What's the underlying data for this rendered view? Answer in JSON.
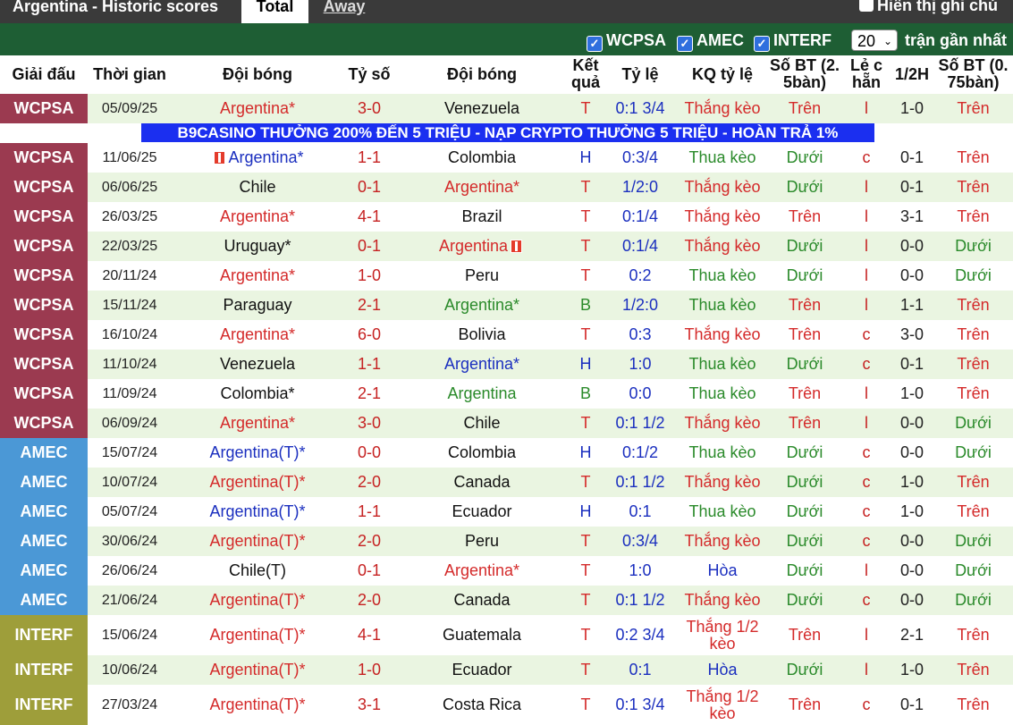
{
  "tabs": {
    "title": "Argentina - Historic scores",
    "total": "Total",
    "away": "Away",
    "show_note": "Hiển thị ghi chú"
  },
  "filters": {
    "wcpsa": "WCPSA",
    "amec": "AMEC",
    "interf": "INTERF",
    "count": "20",
    "count_label": "trận gần nhất"
  },
  "headers": {
    "league": "Giải đấu",
    "time": "Thời gian",
    "home": "Đội bóng",
    "score": "Tỷ số",
    "away": "Đội bóng",
    "result": "Kết quả",
    "handicap": "Tỷ lệ",
    "handicap_result": "KQ tỷ lệ",
    "ou": "Số BT (2. 5bàn)",
    "odd_even": "Lẻ c hẵn",
    "half": "1/2H",
    "ou2": "Số BT (0. 75bàn)"
  },
  "ad_text": "B9CASINO THƯỞNG 200% ĐẾN 5 TRIỆU - NẠP CRYPTO THƯỞNG 5 TRIỆU - HOÀN TRẢ 1%",
  "colors": {
    "wcpsa": "#9b3a50",
    "amec": "#4b98d6",
    "interf": "#9e9e3a",
    "filter_bar": "#1e5e34",
    "ad": "#1b2ff0"
  },
  "rows": [
    {
      "league": "WCPSA",
      "date": "05/09/25",
      "home": "Argentina*",
      "home_color": "red",
      "score": "3-0",
      "away": "Venezuela",
      "away_color": "black",
      "res": "T",
      "hcp": "0:1 3/4",
      "hcpres": "Thắng kèo",
      "ou": "Trên",
      "oe": "l",
      "ht": "1-0",
      "ou2": "Trên"
    },
    {
      "league": "WCPSA",
      "date": "11/06/25",
      "home": "Argentina*",
      "home_color": "blue",
      "home_flag": true,
      "score": "1-1",
      "away": "Colombia",
      "away_color": "black",
      "res": "H",
      "hcp": "0:3/4",
      "hcpres": "Thua kèo",
      "ou": "Dưới",
      "oe": "c",
      "ht": "0-1",
      "ou2": "Trên"
    },
    {
      "league": "WCPSA",
      "date": "06/06/25",
      "home": "Chile",
      "home_color": "black",
      "score": "0-1",
      "away": "Argentina*",
      "away_color": "red",
      "res": "T",
      "hcp": "1/2:0",
      "hcpres": "Thắng kèo",
      "ou": "Dưới",
      "oe": "l",
      "ht": "0-1",
      "ou2": "Trên"
    },
    {
      "league": "WCPSA",
      "date": "26/03/25",
      "home": "Argentina*",
      "home_color": "red",
      "score": "4-1",
      "away": "Brazil",
      "away_color": "black",
      "res": "T",
      "hcp": "0:1/4",
      "hcpres": "Thắng kèo",
      "ou": "Trên",
      "oe": "l",
      "ht": "3-1",
      "ou2": "Trên"
    },
    {
      "league": "WCPSA",
      "date": "22/03/25",
      "home": "Uruguay*",
      "home_color": "black",
      "score": "0-1",
      "away": "Argentina",
      "away_color": "red",
      "away_flag": true,
      "res": "T",
      "hcp": "0:1/4",
      "hcpres": "Thắng kèo",
      "ou": "Dưới",
      "oe": "l",
      "ht": "0-0",
      "ou2": "Dưới"
    },
    {
      "league": "WCPSA",
      "date": "20/11/24",
      "home": "Argentina*",
      "home_color": "red",
      "score": "1-0",
      "away": "Peru",
      "away_color": "black",
      "res": "T",
      "hcp": "0:2",
      "hcpres": "Thua kèo",
      "ou": "Dưới",
      "oe": "l",
      "ht": "0-0",
      "ou2": "Dưới"
    },
    {
      "league": "WCPSA",
      "date": "15/11/24",
      "home": "Paraguay",
      "home_color": "black",
      "score": "2-1",
      "away": "Argentina*",
      "away_color": "green",
      "res": "B",
      "hcp": "1/2:0",
      "hcpres": "Thua kèo",
      "ou": "Trên",
      "oe": "l",
      "ht": "1-1",
      "ou2": "Trên"
    },
    {
      "league": "WCPSA",
      "date": "16/10/24",
      "home": "Argentina*",
      "home_color": "red",
      "score": "6-0",
      "away": "Bolivia",
      "away_color": "black",
      "res": "T",
      "hcp": "0:3",
      "hcpres": "Thắng kèo",
      "ou": "Trên",
      "oe": "c",
      "ht": "3-0",
      "ou2": "Trên"
    },
    {
      "league": "WCPSA",
      "date": "11/10/24",
      "home": "Venezuela",
      "home_color": "black",
      "score": "1-1",
      "away": "Argentina*",
      "away_color": "blue",
      "res": "H",
      "hcp": "1:0",
      "hcpres": "Thua kèo",
      "ou": "Dưới",
      "oe": "c",
      "ht": "0-1",
      "ou2": "Trên"
    },
    {
      "league": "WCPSA",
      "date": "11/09/24",
      "home": "Colombia*",
      "home_color": "black",
      "score": "2-1",
      "away": "Argentina",
      "away_color": "green",
      "res": "B",
      "hcp": "0:0",
      "hcpres": "Thua kèo",
      "ou": "Trên",
      "oe": "l",
      "ht": "1-0",
      "ou2": "Trên"
    },
    {
      "league": "WCPSA",
      "date": "06/09/24",
      "home": "Argentina*",
      "home_color": "red",
      "score": "3-0",
      "away": "Chile",
      "away_color": "black",
      "res": "T",
      "hcp": "0:1 1/2",
      "hcpres": "Thắng kèo",
      "ou": "Trên",
      "oe": "l",
      "ht": "0-0",
      "ou2": "Dưới"
    },
    {
      "league": "AMEC",
      "date": "15/07/24",
      "home": "Argentina(T)*",
      "home_color": "blue",
      "score": "0-0",
      "away": "Colombia",
      "away_color": "black",
      "res": "H",
      "hcp": "0:1/2",
      "hcpres": "Thua kèo",
      "ou": "Dưới",
      "oe": "c",
      "ht": "0-0",
      "ou2": "Dưới"
    },
    {
      "league": "AMEC",
      "date": "10/07/24",
      "home": "Argentina(T)*",
      "home_color": "red",
      "score": "2-0",
      "away": "Canada",
      "away_color": "black",
      "res": "T",
      "hcp": "0:1 1/2",
      "hcpres": "Thắng kèo",
      "ou": "Dưới",
      "oe": "c",
      "ht": "1-0",
      "ou2": "Trên"
    },
    {
      "league": "AMEC",
      "date": "05/07/24",
      "home": "Argentina(T)*",
      "home_color": "blue",
      "score": "1-1",
      "away": "Ecuador",
      "away_color": "black",
      "res": "H",
      "hcp": "0:1",
      "hcpres": "Thua kèo",
      "ou": "Dưới",
      "oe": "c",
      "ht": "1-0",
      "ou2": "Trên"
    },
    {
      "league": "AMEC",
      "date": "30/06/24",
      "home": "Argentina(T)*",
      "home_color": "red",
      "score": "2-0",
      "away": "Peru",
      "away_color": "black",
      "res": "T",
      "hcp": "0:3/4",
      "hcpres": "Thắng kèo",
      "ou": "Dưới",
      "oe": "c",
      "ht": "0-0",
      "ou2": "Dưới"
    },
    {
      "league": "AMEC",
      "date": "26/06/24",
      "home": "Chile(T)",
      "home_color": "black",
      "score": "0-1",
      "away": "Argentina*",
      "away_color": "red",
      "res": "T",
      "hcp": "1:0",
      "hcpres": "Hòa",
      "ou": "Dưới",
      "oe": "l",
      "ht": "0-0",
      "ou2": "Dưới"
    },
    {
      "league": "AMEC",
      "date": "21/06/24",
      "home": "Argentina(T)*",
      "home_color": "red",
      "score": "2-0",
      "away": "Canada",
      "away_color": "black",
      "res": "T",
      "hcp": "0:1 1/2",
      "hcpres": "Thắng kèo",
      "ou": "Dưới",
      "oe": "c",
      "ht": "0-0",
      "ou2": "Dưới"
    },
    {
      "league": "INTERF",
      "date": "15/06/24",
      "home": "Argentina(T)*",
      "home_color": "red",
      "score": "4-1",
      "away": "Guatemala",
      "away_color": "black",
      "res": "T",
      "hcp": "0:2 3/4",
      "hcpres": "Thắng 1/2 kèo",
      "ou": "Trên",
      "oe": "l",
      "ht": "2-1",
      "ou2": "Trên"
    },
    {
      "league": "INTERF",
      "date": "10/06/24",
      "home": "Argentina(T)*",
      "home_color": "red",
      "score": "1-0",
      "away": "Ecuador",
      "away_color": "black",
      "res": "T",
      "hcp": "0:1",
      "hcpres": "Hòa",
      "ou": "Dưới",
      "oe": "l",
      "ht": "1-0",
      "ou2": "Trên"
    },
    {
      "league": "INTERF",
      "date": "27/03/24",
      "home": "Argentina(T)*",
      "home_color": "red",
      "score": "3-1",
      "away": "Costa Rica",
      "away_color": "black",
      "res": "T",
      "hcp": "0:1 3/4",
      "hcpres": "Thắng 1/2 kèo",
      "ou": "Trên",
      "oe": "c",
      "ht": "0-1",
      "ou2": "Trên"
    }
  ]
}
